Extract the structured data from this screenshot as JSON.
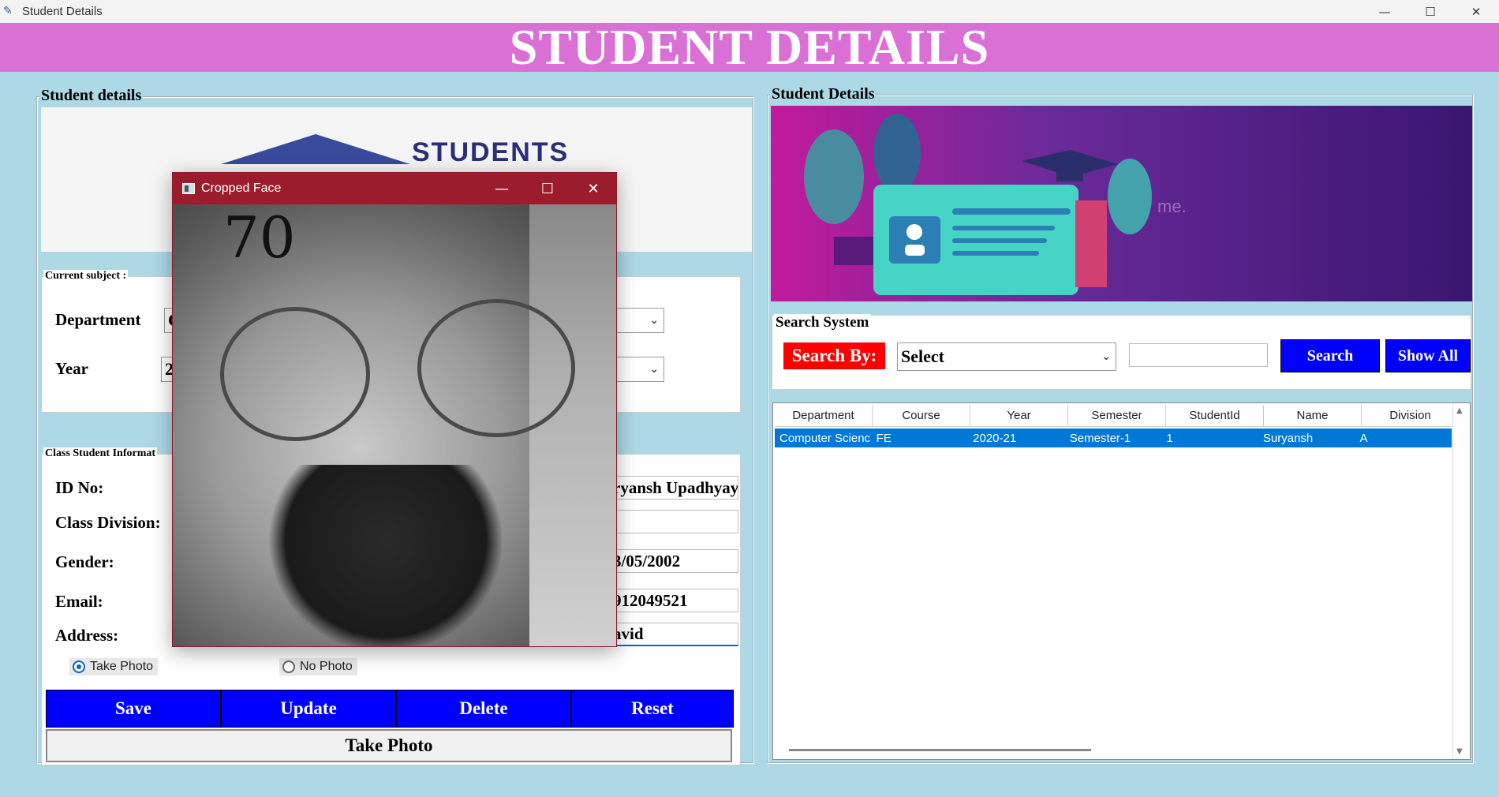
{
  "window": {
    "title": "Student Details",
    "controls": {
      "minimize": "—",
      "maximize": "☐",
      "close": "✕"
    }
  },
  "banner": {
    "title": "STUDENT DETAILS"
  },
  "left": {
    "frame_title": "Student details",
    "logo_text": "STUDENTS",
    "current_subject": {
      "title": "Current subject :",
      "department_label": "Department",
      "department_value": "C",
      "year_label": "Year",
      "year_value": "2"
    },
    "class_info": {
      "title": "Class Student Informat",
      "id_label": "ID No:",
      "division_label": "Class Division:",
      "gender_label": "Gender:",
      "email_label": "Email:",
      "address_label": "Address:",
      "name_value": "ryansh Upadhyay",
      "division_right_value": "",
      "dob_value": "3/05/2002",
      "phone_value": "912049521",
      "teacher_value": "avid"
    },
    "radios": {
      "take_photo": "Take Photo",
      "no_photo": "No Photo"
    },
    "buttons": {
      "save": "Save",
      "update": "Update",
      "delete": "Delete",
      "reset": "Reset",
      "take_photo": "Take Photo"
    }
  },
  "right": {
    "frame_title": "Student Details",
    "banner_watermark": "me.",
    "search": {
      "title": "Search System",
      "label": "Search By:",
      "select_value": "Select",
      "input_value": "",
      "search_button": "Search",
      "show_all_button": "Show All"
    },
    "table": {
      "columns": [
        "Department",
        "Course",
        "Year",
        "Semester",
        "StudentId",
        "Name",
        "Division"
      ],
      "rows": [
        [
          "Computer Scienc",
          "FE",
          "2020-21",
          "Semester-1",
          "1",
          "Suryansh",
          "A"
        ]
      ]
    }
  },
  "cropped_window": {
    "title": "Cropped Face",
    "score": "70",
    "controls": {
      "minimize": "—",
      "maximize": "☐",
      "close": "✕"
    }
  }
}
